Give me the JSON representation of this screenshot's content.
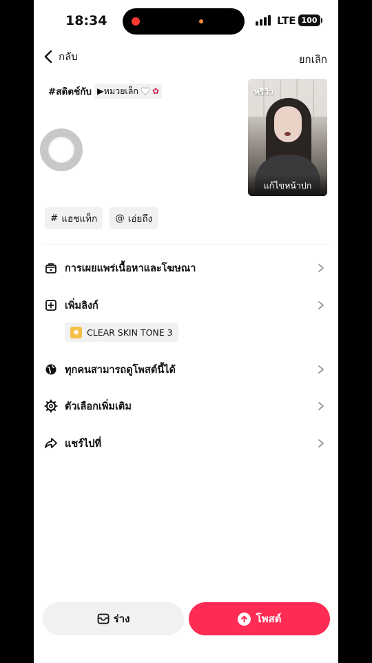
{
  "status_bar": {
    "time": "18:34",
    "network": "LTE",
    "battery": "100"
  },
  "header": {
    "back_label": "กลับ",
    "cancel_label": "ยกเลิก"
  },
  "caption": {
    "hashtag": "#สติตช์กับ",
    "mention": "▶หมวยเล็ก"
  },
  "thumbnail": {
    "overlay_tag": "พรีวิว",
    "edit_cover_label": "แก้ไขหน้าปก"
  },
  "chips": {
    "hashtag_label": "แฮชแท็ก",
    "mention_label": "เอ่ยถึง"
  },
  "rows": {
    "disclosure_label": "การเผยแพร่เนื้อหาและโฆษณา",
    "add_link_label": "เพิ่มลิงก์",
    "product_label": "CLEAR SKIN TONE 3",
    "privacy_label": "ทุกคนสามารถดูโพสต์นี้ได้",
    "more_options_label": "ตัวเลือกเพิ่มเติม",
    "share_to_label": "แชร์ไปที่"
  },
  "footer": {
    "draft_label": "ร่าง",
    "post_label": "โพสต์"
  },
  "colors": {
    "accent": "#fe2c55",
    "chip_bg": "#f1f1f2"
  }
}
